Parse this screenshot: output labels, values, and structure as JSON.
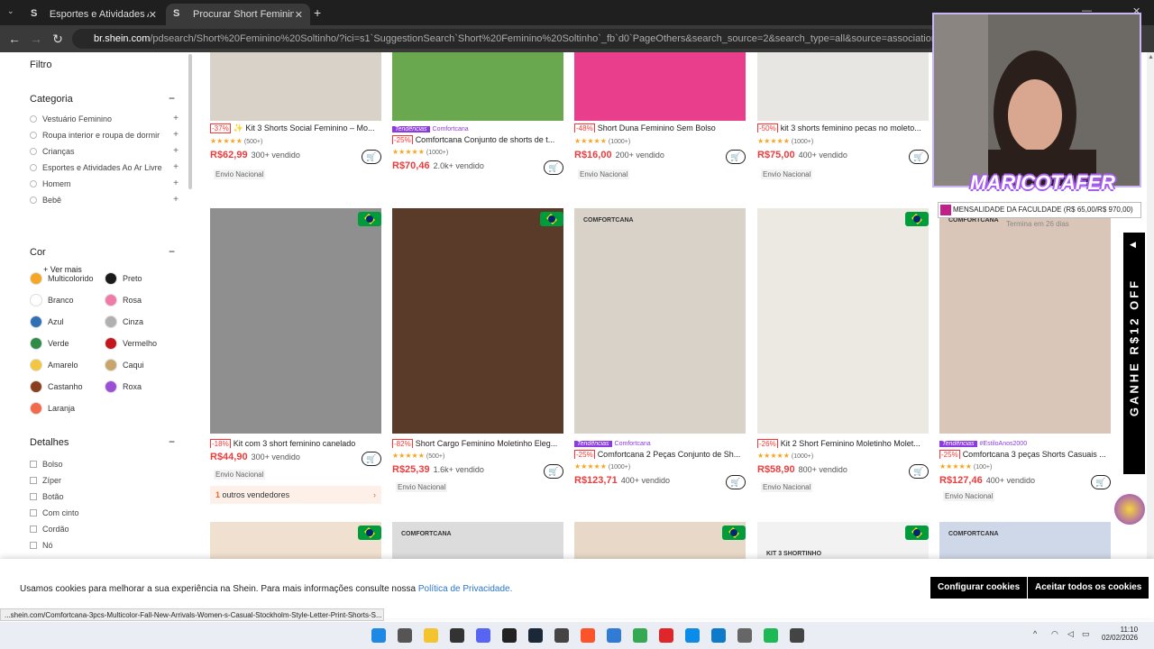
{
  "browser": {
    "tabs": [
      {
        "title": "Esportes e Atividades Ao Ar Livre",
        "favicon": "S"
      },
      {
        "title": "Procurar Short Feminino Soltinho",
        "favicon": "S"
      }
    ],
    "url_domain": "br.shein.com",
    "url_path": "/pdsearch/Short%20Feminino%20Soltinho/?ici=s1`SuggestionSearch`Short%20Feminino%20Soltinho`_fb`d0`PageOthers&search_source=2&search_type=all&source=association&src_identifier=st%3D4%26sc%3DSh"
  },
  "sidebar": {
    "filter_title": "Filtro",
    "category_title": "Categoria",
    "categories": [
      "Vestuário Feminino",
      "Roupa interior e roupa de dormir",
      "Crianças",
      "Esportes e Atividades Ao Ar Livre",
      "Homem",
      "Bebê"
    ],
    "see_more": "+ Ver mais",
    "color_title": "Cor",
    "colors": [
      {
        "name": "Multicolorido",
        "hex": "#f5a623"
      },
      {
        "name": "Preto",
        "hex": "#1a1a1a"
      },
      {
        "name": "Branco",
        "hex": "#ffffff"
      },
      {
        "name": "Rosa",
        "hex": "#f27aa8"
      },
      {
        "name": "Azul",
        "hex": "#2f6fb5"
      },
      {
        "name": "Cinza",
        "hex": "#b0b0b0"
      },
      {
        "name": "Verde",
        "hex": "#2e8b4a"
      },
      {
        "name": "Vermelho",
        "hex": "#c4161c"
      },
      {
        "name": "Amarelo",
        "hex": "#f3c640"
      },
      {
        "name": "Caqui",
        "hex": "#c9a56a"
      },
      {
        "name": "Castanho",
        "hex": "#8a3e1e"
      },
      {
        "name": "Roxa",
        "hex": "#9b4fd8"
      },
      {
        "name": "Laranja",
        "hex": "#f26a4a"
      }
    ],
    "details_title": "Detalhes",
    "details": [
      "Bolso",
      "Zíper",
      "Botão",
      "Com cinto",
      "Cordão",
      "Nó"
    ]
  },
  "products_row1": [
    {
      "disc": "-37%",
      "name": "✨ Kit 3 Shorts Social Feminino – Mo...",
      "rating": "(500+)",
      "price": "R$62,99",
      "sold": "300+ vendido",
      "ship": "Envio Nacional"
    },
    {
      "disc": "-25%",
      "trend": "Tendências",
      "tag": "Comfortcana",
      "name": "Comfortcana Conjunto de shorts de t...",
      "rating": "(1000+)",
      "price": "R$70,46",
      "sold": "2.0k+ vendido",
      "ship": ""
    },
    {
      "disc": "-48%",
      "name": "Short Duna Feminino Sem Bolso",
      "rating": "(1000+)",
      "price": "R$16,00",
      "sold": "200+ vendido",
      "ship": "Envio Nacional"
    },
    {
      "disc": "-50%",
      "name": "kit 3 shorts feminino pecas no moleto...",
      "rating": "(1000+)",
      "price": "R$75,00",
      "sold": "400+ vendido",
      "ship": "Envio Nacional"
    }
  ],
  "products_row2": [
    {
      "disc": "-18%",
      "name": "Kit com 3 short feminino canelado",
      "rating": "",
      "price": "R$44,90",
      "sold": "300+ vendido",
      "ship": "Envio Nacional",
      "vendors": "outros vendedores",
      "vendors_n": "1",
      "img": "#8f8f8f",
      "brand": ""
    },
    {
      "disc": "-82%",
      "name": "Short Cargo Feminino Moletinho Eleg...",
      "rating": "(500+)",
      "price": "R$25,39",
      "sold": "1.6k+ vendido",
      "ship": "Envio Nacional",
      "img": "#5a3a28",
      "brand": ""
    },
    {
      "disc": "-25%",
      "trend": "Tendências",
      "tag": "Comfortcana",
      "name": "Comfortcana 2 Peças Conjunto de Sh...",
      "rating": "(1000+)",
      "price": "R$123,71",
      "sold": "400+ vendido",
      "ship": "",
      "img": "#d8d2c8",
      "brand": "COMFORTCANA"
    },
    {
      "disc": "-26%",
      "name": "Kit 2 Short Feminino Moletinho Molet...",
      "rating": "(1000+)",
      "price": "R$58,90",
      "sold": "800+ vendido",
      "ship": "Envio Nacional",
      "img": "#ece8e2",
      "brand": ""
    },
    {
      "disc": "-25%",
      "trend": "Tendências",
      "tag": "#EstiloAnos2000",
      "name": "Comfortcana 3 peças Shorts Casuais ...",
      "rating": "(100+)",
      "price": "R$127,46",
      "sold": "400+ vendido",
      "ship": "Envio Nacional",
      "img": "#d9c6b8",
      "brand": "COMFORTCANA"
    }
  ],
  "row3_brands": [
    "COMFORTCANA",
    "COMFORTCANA",
    "KIT 3 SHORTINHO"
  ],
  "cookie": {
    "message": "Usamos cookies para melhorar a sua experiência na Shein. Para mais informações consulte nossa ",
    "link": "Política de Privacidade.",
    "config": "Configurar cookies",
    "accept": "Aceitar todos os cookies"
  },
  "status_url": "...shein.com/Comfortcana-3pcs-Multicolor-Fall-New-Arrivals-Women-s-Casual-Stockholm-Style-Letter-Print-Shorts-S...",
  "overlay": {
    "streamer": "MARICOTAFER",
    "bar": "MENSALIDADE DA FACULDADE (R$ 65,00/R$ 970,00)",
    "sub": "Termina em 26 dias",
    "banner": "GANHE R$12 OFF"
  },
  "clock": {
    "time": "11:10",
    "date": "02/02/2026"
  }
}
